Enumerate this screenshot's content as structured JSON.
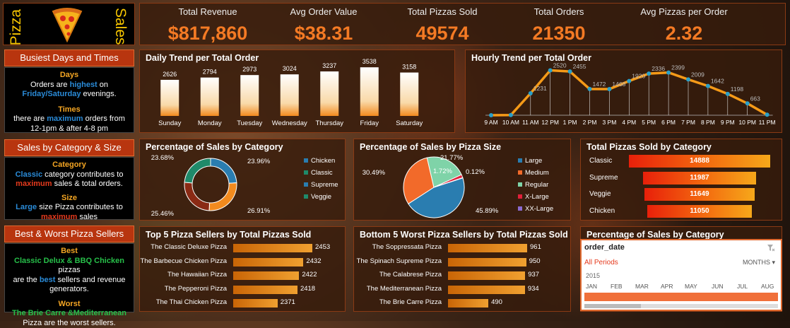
{
  "logo": {
    "word1": "Pizza",
    "word2": "Sales"
  },
  "kpis": [
    {
      "label": "Total Revenue",
      "value": "$817,860"
    },
    {
      "label": "Avg Order Value",
      "value": "$38.31"
    },
    {
      "label": "Total Pizzas Sold",
      "value": "49574"
    },
    {
      "label": "Total  Orders",
      "value": "21350"
    },
    {
      "label": "Avg Pizzas per Order",
      "value": "2.32"
    }
  ],
  "insights": {
    "busiest": {
      "title": "Busiest Days and Times",
      "days_h": "Days",
      "days_1a": "Orders are ",
      "days_1b": "highest",
      "days_1c": " on",
      "days_2": "Friday/Saturday",
      "days_3": " evenings.",
      "times_h": "Times",
      "times_1a": "there are ",
      "times_1b": "maximum",
      "times_1c": " orders from",
      "times_2": "12-1pm & after 4-8 pm"
    },
    "category": {
      "title": "Sales by Category & Size",
      "cat_h": "Category",
      "cat_1a": "Classic",
      "cat_1b": " category contributes to",
      "cat_2a": "maximum",
      "cat_2b": " sales & total orders.",
      "size_h": "Size",
      "size_1a": "Large",
      "size_1b": " size Pizza contributes to",
      "size_2a": "maximum",
      "size_2b": " sales"
    },
    "sellers": {
      "title": "Best & Worst Pizza Sellers",
      "best_h": "Best",
      "best_1": "Classic Delux & BBQ Chicken",
      "best_1b": " pizzas",
      "best_2a": "are the ",
      "best_2b": "best",
      "best_2c": " sellers and revenue",
      "best_3": "generators.",
      "worst_h": "Worst",
      "worst_1": "The Brie Carre &Mediterranean",
      "worst_2": "Pizza are the worst sellers."
    }
  },
  "chart_data": [
    {
      "id": "daily",
      "type": "bar",
      "title": "Daily Trend per Total Order",
      "categories": [
        "Sunday",
        "Monday",
        "Tuesday",
        "Wednesday",
        "Thursday",
        "Friday",
        "Saturday"
      ],
      "values": [
        2626,
        2794,
        2973,
        3024,
        3237,
        3538,
        3158
      ],
      "ylim": [
        0,
        3600
      ]
    },
    {
      "id": "hourly",
      "type": "line",
      "title": "Hourly Trend per Total Order",
      "categories": [
        "9 AM",
        "10 AM",
        "11 AM",
        "12 PM",
        "1 PM",
        "2 PM",
        "3 PM",
        "4 PM",
        "5 PM",
        "6 PM",
        "7 PM",
        "8 PM",
        "9 PM",
        "10 PM",
        "11 PM"
      ],
      "values": [
        1,
        8,
        1231,
        2520,
        2455,
        1472,
        1468,
        1920,
        2336,
        2399,
        2009,
        1642,
        1198,
        663,
        28
      ],
      "labels": [
        "",
        "",
        "1231",
        "2520",
        "2455",
        "1472",
        "1468",
        "1920",
        "2336",
        "2399",
        "2009",
        "1642",
        "1198",
        "663",
        ""
      ],
      "ylim": [
        0,
        2700
      ]
    },
    {
      "id": "cat_pct",
      "type": "pie",
      "title": "Percentage of Sales by Category",
      "categories": [
        "Chicken",
        "Classic",
        "Supreme",
        "Veggie"
      ],
      "values": [
        23.96,
        26.91,
        25.46,
        23.68
      ],
      "labels": [
        "23.96%",
        "26.91%",
        "25.46%",
        "23.68%"
      ],
      "colors": [
        "#2a7db0",
        "#f28a1e",
        "#8a2a14",
        "#1f8a6a"
      ]
    },
    {
      "id": "size_pct",
      "type": "pie",
      "title": "Percentage of Sales by Pizza Size",
      "categories": [
        "Large",
        "Medium",
        "Regular",
        "X-Large",
        "XX-Large"
      ],
      "values": [
        45.89,
        30.49,
        21.77,
        1.72,
        0.12
      ],
      "labels": [
        "45.89%",
        "30.49%",
        "21.77%",
        "1.72%",
        "0.12%"
      ],
      "colors": [
        "#2a7db0",
        "#f26a2a",
        "#7fd3a8",
        "#e0203a",
        "#8a6ad0"
      ]
    },
    {
      "id": "cat_total",
      "type": "bar",
      "title": "Total Pizzas Sold by Category",
      "categories": [
        "Classic",
        "Supreme",
        "Veggie",
        "Chicken"
      ],
      "values": [
        14888,
        11987,
        11649,
        11050
      ]
    },
    {
      "id": "top5",
      "type": "bar",
      "title": "Top 5 Pizza Sellers by Total Pizzas Sold",
      "categories": [
        "The Classic Deluxe Pizza",
        "The Barbecue Chicken Pizza",
        "The Hawaiian Pizza",
        "The Pepperoni Pizza",
        "The Thai Chicken Pizza"
      ],
      "values": [
        2453,
        2432,
        2422,
        2418,
        2371
      ]
    },
    {
      "id": "bottom5",
      "type": "bar",
      "title": "Bottom 5 Worst Pizza Sellers by Total Pizzas Sold",
      "categories": [
        "The Soppressata Pizza",
        "The Spinach Supreme Pizza",
        "The Calabrese Pizza",
        "The Mediterranean Pizza",
        "The Brie Carre Pizza"
      ],
      "values": [
        961,
        950,
        937,
        934,
        490
      ]
    }
  ],
  "slicer": {
    "title": "Percentage of Sales by Category",
    "field": "order_date",
    "period": "All Periods",
    "unit": "MONTHS",
    "year": "2015",
    "months": [
      "JAN",
      "FEB",
      "MAR",
      "APR",
      "MAY",
      "JUN",
      "JUL",
      "AUG"
    ]
  }
}
